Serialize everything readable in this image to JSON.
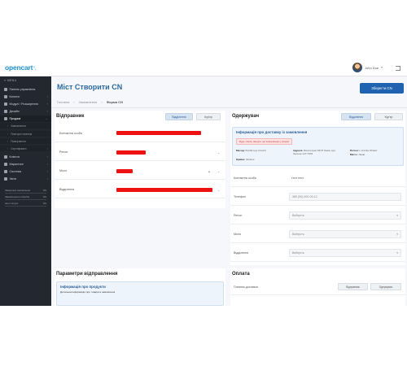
{
  "header": {
    "logo": "opencart",
    "logo_cart": "ʽ˔",
    "user_name": "John Doe",
    "user_caret": "▾"
  },
  "sidebar": {
    "menu_label": "≡ MENU",
    "items": [
      {
        "label": "Панель управління",
        "icon": "dashboard-icon"
      },
      {
        "label": "Каталог",
        "icon": "tag-icon"
      },
      {
        "label": "Модулі / Розширення",
        "icon": "puzzle-icon"
      },
      {
        "label": "Дизайн",
        "icon": "monitor-icon"
      },
      {
        "label": "Продажі",
        "icon": "cart-icon"
      },
      {
        "label": "Клієнти",
        "icon": "user-icon"
      },
      {
        "label": "Маркетинг",
        "icon": "share-icon"
      },
      {
        "label": "Система",
        "icon": "gear-icon"
      },
      {
        "label": "Звіти",
        "icon": "chart-icon"
      }
    ],
    "subitems": [
      "Замовлення",
      "Повторні платежі",
      "Повернення",
      "Сертифікати"
    ],
    "stats": [
      {
        "label": "Завершені замовлення",
        "value": "0%",
        "fill": 0
      },
      {
        "label": "Замовлення в обробці",
        "value": "0%",
        "fill": 0
      },
      {
        "label": "Інші статуси",
        "value": "0%",
        "fill": 0
      }
    ]
  },
  "page": {
    "title": "Міст Створити CN",
    "breadcrumb": [
      "Головна",
      "Замовлення",
      "Форма CN"
    ],
    "breadcrumb_sep": "›",
    "save_label": "Зберегти CN"
  },
  "sender": {
    "title": "Відправник",
    "tabs": [
      "Відділення",
      "Кур'єр"
    ],
    "fields": [
      "Контактна особа",
      "Регіон",
      "Місто",
      "Відділення"
    ]
  },
  "recipient": {
    "title": "Одержувач",
    "tabs": [
      "Відділення",
      "Кур'єр"
    ],
    "info_title": "Інформація про доставку із замовлення",
    "warning": "Будь ласка, введіть цю інформацію у формі",
    "kv": [
      {
        "k": "Метод:",
        "v": "flat.Метод: branch"
      },
      {
        "k": "Адреса:",
        "v": "Багатолуки МСП Львів, вул. Зелена 147 ПУМ"
      },
      {
        "k": "Регіон:",
        "v": "L'vivs'ka Oblast'"
      },
      {
        "k": "Місто:",
        "v": "Львів"
      },
      {
        "k": "Країна:",
        "v": "Ukraine"
      }
    ],
    "contact_label": "Контактна особа",
    "contact_value": "тест тест",
    "phone_label": "Телефон",
    "phone_value": "380 (50) 000-00-12",
    "region_label": "Регіон",
    "region_value": "Виберіть",
    "city_label": "Місто",
    "city_value": "Виберіть",
    "branch_label": "Відділення",
    "branch_value": "Виберіть",
    "arrow": "▾"
  },
  "shipment": {
    "title": "Параметри відправлення",
    "info_title": "Інформація про продукти",
    "info_text": "Детальна інформація про товари в замовленні"
  },
  "payment": {
    "title": "Оплата",
    "payer_label": "Платник доставки",
    "buttons": [
      "Відправник",
      "Одержувач"
    ]
  },
  "colors": {
    "accent": "#1e62b0",
    "sidebar_bg": "#232830",
    "redaction": "#ee1111"
  }
}
